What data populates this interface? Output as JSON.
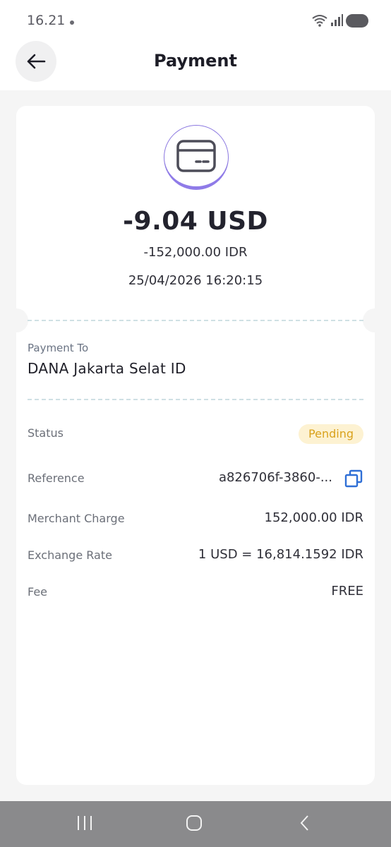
{
  "status_bar": {
    "time": "16.21"
  },
  "header": {
    "title": "Payment",
    "back_icon": "arrow-left-icon"
  },
  "summary": {
    "icon": "card-icon",
    "amount": "-9.04 USD",
    "amount_local": "-152,000.00 IDR",
    "datetime": "25/04/2026 16:20:15"
  },
  "payment_to": {
    "label": "Payment To",
    "value": "DANA Jakarta Selat ID"
  },
  "details": {
    "status_label": "Status",
    "status_value": "Pending",
    "reference_label": "Reference",
    "reference_value": "a826706f-3860-...",
    "merchant_charge_label": "Merchant Charge",
    "merchant_charge_value": "152,000.00 IDR",
    "exchange_rate_label": "Exchange Rate",
    "exchange_rate_value": "1 USD = 16,814.1592 IDR",
    "fee_label": "Fee",
    "fee_value": "FREE"
  },
  "colors": {
    "accent": "#8f7be8",
    "pending_bg": "#fdf2d2",
    "pending_text": "#d9a21c",
    "copy_icon": "#2f6fd6"
  },
  "nav_bar": {
    "recents_icon": "recents-icon",
    "home_icon": "home-icon",
    "back_icon": "back-chevron-icon"
  }
}
